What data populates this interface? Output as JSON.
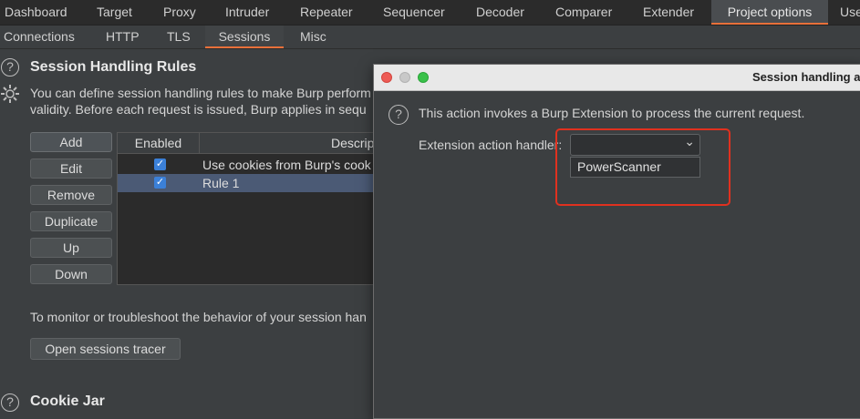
{
  "top_tabs": [
    "Dashboard",
    "Target",
    "Proxy",
    "Intruder",
    "Repeater",
    "Sequencer",
    "Decoder",
    "Comparer",
    "Extender",
    "Project options",
    "Use"
  ],
  "active_top_tab": "Project options",
  "sub_tabs": [
    "Connections",
    "HTTP",
    "TLS",
    "Sessions",
    "Misc"
  ],
  "active_sub_tab": "Sessions",
  "session_rules": {
    "heading": "Session Handling Rules",
    "description_line1": "You can define session handling rules to make Burp perform",
    "description_line2": "validity. Before each request is issued, Burp applies in sequ",
    "buttons": [
      "Add",
      "Edit",
      "Remove",
      "Duplicate",
      "Up",
      "Down"
    ],
    "table": {
      "columns": [
        "Enabled",
        "Descrip"
      ],
      "rows": [
        {
          "enabled": true,
          "description": "Use cookies from Burp's cook"
        },
        {
          "enabled": true,
          "description": "Rule 1"
        }
      ]
    },
    "monitor_text": "To monitor or troubleshoot the behavior of your session han",
    "tracer_button": "Open sessions tracer"
  },
  "cookie_jar": {
    "heading": "Cookie Jar"
  },
  "dialog": {
    "title": "Session handling a",
    "info_text": "This action invokes a Burp Extension to process the current request.",
    "field_label": "Extension action handler:",
    "selected_value": "",
    "options": [
      "PowerScanner"
    ]
  },
  "colors": {
    "accent": "#e8703a",
    "highlight_box": "#e0311f",
    "selection": "#4b5a75"
  }
}
